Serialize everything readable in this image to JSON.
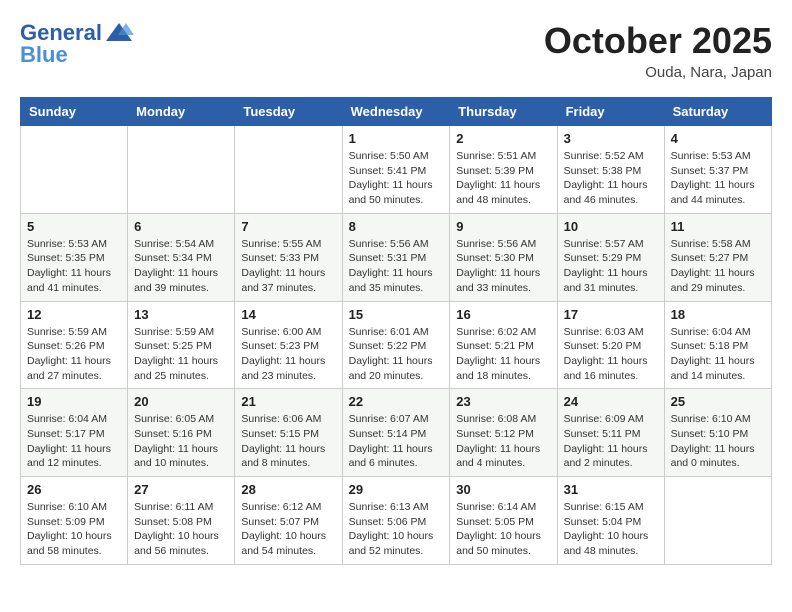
{
  "header": {
    "logo_general": "General",
    "logo_blue": "Blue",
    "month_title": "October 2025",
    "location": "Ouda, Nara, Japan"
  },
  "days_of_week": [
    "Sunday",
    "Monday",
    "Tuesday",
    "Wednesday",
    "Thursday",
    "Friday",
    "Saturday"
  ],
  "weeks": [
    [
      {
        "day": "",
        "info": ""
      },
      {
        "day": "",
        "info": ""
      },
      {
        "day": "",
        "info": ""
      },
      {
        "day": "1",
        "info": "Sunrise: 5:50 AM\nSunset: 5:41 PM\nDaylight: 11 hours\nand 50 minutes."
      },
      {
        "day": "2",
        "info": "Sunrise: 5:51 AM\nSunset: 5:39 PM\nDaylight: 11 hours\nand 48 minutes."
      },
      {
        "day": "3",
        "info": "Sunrise: 5:52 AM\nSunset: 5:38 PM\nDaylight: 11 hours\nand 46 minutes."
      },
      {
        "day": "4",
        "info": "Sunrise: 5:53 AM\nSunset: 5:37 PM\nDaylight: 11 hours\nand 44 minutes."
      }
    ],
    [
      {
        "day": "5",
        "info": "Sunrise: 5:53 AM\nSunset: 5:35 PM\nDaylight: 11 hours\nand 41 minutes."
      },
      {
        "day": "6",
        "info": "Sunrise: 5:54 AM\nSunset: 5:34 PM\nDaylight: 11 hours\nand 39 minutes."
      },
      {
        "day": "7",
        "info": "Sunrise: 5:55 AM\nSunset: 5:33 PM\nDaylight: 11 hours\nand 37 minutes."
      },
      {
        "day": "8",
        "info": "Sunrise: 5:56 AM\nSunset: 5:31 PM\nDaylight: 11 hours\nand 35 minutes."
      },
      {
        "day": "9",
        "info": "Sunrise: 5:56 AM\nSunset: 5:30 PM\nDaylight: 11 hours\nand 33 minutes."
      },
      {
        "day": "10",
        "info": "Sunrise: 5:57 AM\nSunset: 5:29 PM\nDaylight: 11 hours\nand 31 minutes."
      },
      {
        "day": "11",
        "info": "Sunrise: 5:58 AM\nSunset: 5:27 PM\nDaylight: 11 hours\nand 29 minutes."
      }
    ],
    [
      {
        "day": "12",
        "info": "Sunrise: 5:59 AM\nSunset: 5:26 PM\nDaylight: 11 hours\nand 27 minutes."
      },
      {
        "day": "13",
        "info": "Sunrise: 5:59 AM\nSunset: 5:25 PM\nDaylight: 11 hours\nand 25 minutes."
      },
      {
        "day": "14",
        "info": "Sunrise: 6:00 AM\nSunset: 5:23 PM\nDaylight: 11 hours\nand 23 minutes."
      },
      {
        "day": "15",
        "info": "Sunrise: 6:01 AM\nSunset: 5:22 PM\nDaylight: 11 hours\nand 20 minutes."
      },
      {
        "day": "16",
        "info": "Sunrise: 6:02 AM\nSunset: 5:21 PM\nDaylight: 11 hours\nand 18 minutes."
      },
      {
        "day": "17",
        "info": "Sunrise: 6:03 AM\nSunset: 5:20 PM\nDaylight: 11 hours\nand 16 minutes."
      },
      {
        "day": "18",
        "info": "Sunrise: 6:04 AM\nSunset: 5:18 PM\nDaylight: 11 hours\nand 14 minutes."
      }
    ],
    [
      {
        "day": "19",
        "info": "Sunrise: 6:04 AM\nSunset: 5:17 PM\nDaylight: 11 hours\nand 12 minutes."
      },
      {
        "day": "20",
        "info": "Sunrise: 6:05 AM\nSunset: 5:16 PM\nDaylight: 11 hours\nand 10 minutes."
      },
      {
        "day": "21",
        "info": "Sunrise: 6:06 AM\nSunset: 5:15 PM\nDaylight: 11 hours\nand 8 minutes."
      },
      {
        "day": "22",
        "info": "Sunrise: 6:07 AM\nSunset: 5:14 PM\nDaylight: 11 hours\nand 6 minutes."
      },
      {
        "day": "23",
        "info": "Sunrise: 6:08 AM\nSunset: 5:12 PM\nDaylight: 11 hours\nand 4 minutes."
      },
      {
        "day": "24",
        "info": "Sunrise: 6:09 AM\nSunset: 5:11 PM\nDaylight: 11 hours\nand 2 minutes."
      },
      {
        "day": "25",
        "info": "Sunrise: 6:10 AM\nSunset: 5:10 PM\nDaylight: 11 hours\nand 0 minutes."
      }
    ],
    [
      {
        "day": "26",
        "info": "Sunrise: 6:10 AM\nSunset: 5:09 PM\nDaylight: 10 hours\nand 58 minutes."
      },
      {
        "day": "27",
        "info": "Sunrise: 6:11 AM\nSunset: 5:08 PM\nDaylight: 10 hours\nand 56 minutes."
      },
      {
        "day": "28",
        "info": "Sunrise: 6:12 AM\nSunset: 5:07 PM\nDaylight: 10 hours\nand 54 minutes."
      },
      {
        "day": "29",
        "info": "Sunrise: 6:13 AM\nSunset: 5:06 PM\nDaylight: 10 hours\nand 52 minutes."
      },
      {
        "day": "30",
        "info": "Sunrise: 6:14 AM\nSunset: 5:05 PM\nDaylight: 10 hours\nand 50 minutes."
      },
      {
        "day": "31",
        "info": "Sunrise: 6:15 AM\nSunset: 5:04 PM\nDaylight: 10 hours\nand 48 minutes."
      },
      {
        "day": "",
        "info": ""
      }
    ]
  ]
}
